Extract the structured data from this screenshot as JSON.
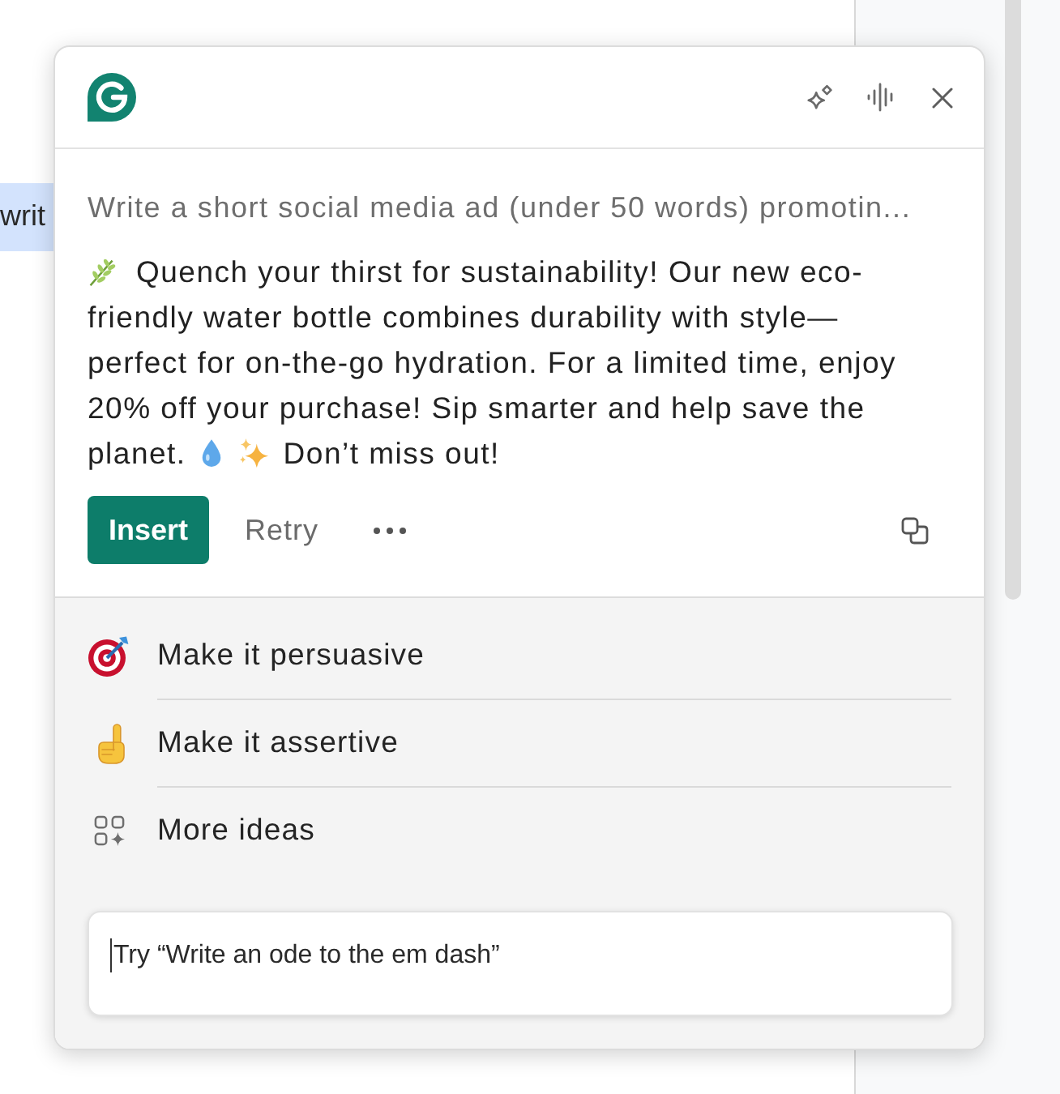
{
  "document": {
    "selected_text": "writ"
  },
  "assistant": {
    "prompt": "Write a short social media ad (under 50 words) promotin...",
    "response": {
      "text": "Quench your thirst for sustainability! Our new eco-friendly water bottle combines durability with style—perfect for on-the-go hydration. For a limited time, enjoy 20% off your purchase! Sip smarter and help save the planet.",
      "closing": "Don’t miss out!"
    },
    "actions": [
      {
        "label": "Insert",
        "kind": "primary"
      },
      {
        "label": "Retry",
        "kind": "secondary"
      }
    ],
    "suggestions": [
      {
        "label": "Make it persuasive"
      },
      {
        "label": "Make it assertive"
      },
      {
        "label": "More ideas"
      }
    ],
    "input": {
      "placeholder": "Try “Write an ode to the em dash”"
    }
  }
}
